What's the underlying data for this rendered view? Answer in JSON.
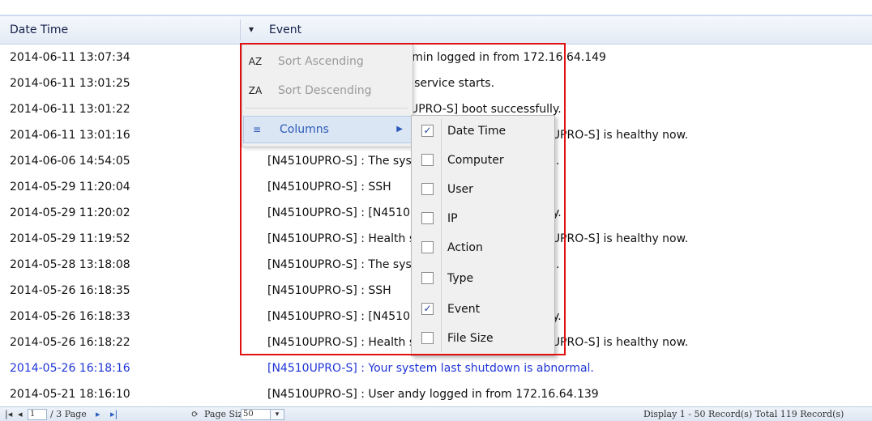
{
  "header": {
    "col_datetime": "Date Time",
    "col_event": "Event",
    "dropdown_icon": "triangle-down"
  },
  "rows": [
    {
      "date": "2014-06-11 13:07:34",
      "event": "[N4510UPRO-S] : User admin logged in from 172.16.64.149"
    },
    {
      "date": "2014-06-11 13:01:25",
      "event": "[N4510UPRO-S] : System service starts."
    },
    {
      "date": "2014-06-11 13:01:22",
      "event": "[N4510UPRO-S] : [N4510UPRO-S] boot successfully."
    },
    {
      "date": "2014-06-11 13:01:16",
      "event": "[N4510UPRO-S] : Health status on system [N4510UPRO-S] is healthy now."
    },
    {
      "date": "2014-06-06 14:54:05",
      "event": "[N4510UPRO-S] : The system is going to shutdown."
    },
    {
      "date": "2014-05-29 11:20:04",
      "event": "[N4510UPRO-S] : SSH"
    },
    {
      "date": "2014-05-29 11:20:02",
      "event": "[N4510UPRO-S] : [N4510UPRO-S] boot successfully."
    },
    {
      "date": "2014-05-29 11:19:52",
      "event": "[N4510UPRO-S] : Health status on system [N4510UPRO-S] is healthy now."
    },
    {
      "date": "2014-05-28 13:18:08",
      "event": "[N4510UPRO-S] : The system is going to shutdown."
    },
    {
      "date": "2014-05-26 16:18:35",
      "event": "[N4510UPRO-S] : SSH"
    },
    {
      "date": "2014-05-26 16:18:33",
      "event": "[N4510UPRO-S] : [N4510UPRO-S] boot successfully."
    },
    {
      "date": "2014-05-26 16:18:22",
      "event": "[N4510UPRO-S] : Health status on system [N4510UPRO-S] is healthy now."
    },
    {
      "date": "2014-05-26 16:18:16",
      "event": "[N4510UPRO-S] : Your system last shutdown is abnormal.",
      "highlight": "#1f35d6"
    },
    {
      "date": "2014-05-21 18:16:10",
      "event": "[N4510UPRO-S] : User andy logged in from 172.16.64.139"
    }
  ],
  "context_menu": {
    "sort_ascending": "Sort Ascending",
    "sort_descending": "Sort Descending",
    "columns": "Columns",
    "sort_ascending_icon": "AZ",
    "sort_descending_icon": "ZA",
    "columns_icon": "≡"
  },
  "columns_menu": [
    {
      "label": "Date Time",
      "checked": true
    },
    {
      "label": "Computer",
      "checked": false
    },
    {
      "label": "User",
      "checked": false
    },
    {
      "label": "IP",
      "checked": false
    },
    {
      "label": "Action",
      "checked": false
    },
    {
      "label": "Type",
      "checked": false
    },
    {
      "label": "Event",
      "checked": true
    },
    {
      "label": "File Size",
      "checked": false
    }
  ],
  "pager": {
    "page_value": "1",
    "page_of": "/ 3 Page",
    "page_size_label": "Page Size",
    "page_size_value": "50",
    "status": "Display 1 - 50 Record(s) Total 119 Record(s)"
  },
  "colors": {
    "highlight_border": "#e01010",
    "blue_row": "#1f35d6"
  }
}
